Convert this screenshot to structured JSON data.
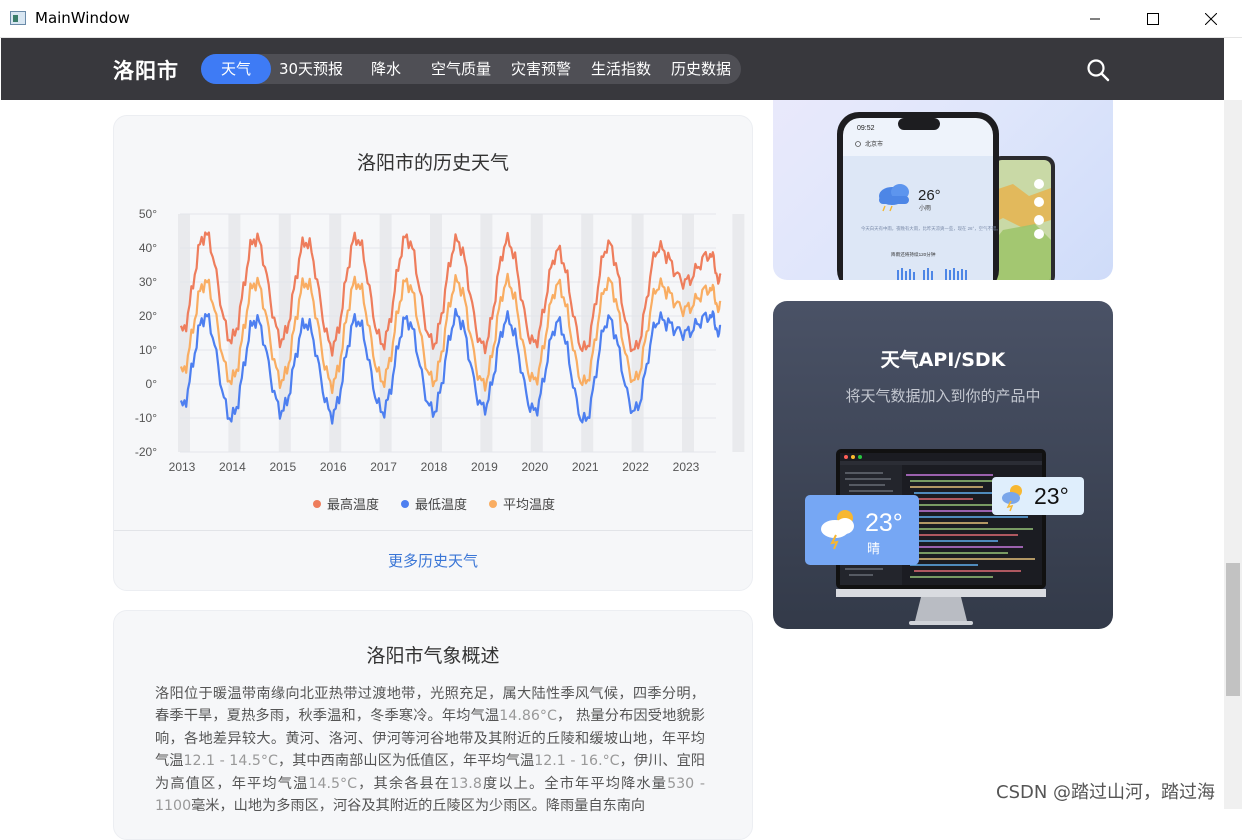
{
  "window": {
    "title": "MainWindow"
  },
  "nav": {
    "city": "洛阳市",
    "tabs": [
      {
        "label": "天气",
        "active": true
      },
      {
        "label": "30天预报",
        "active": false
      },
      {
        "label": "降水",
        "active": false
      },
      {
        "label": "空气质量",
        "active": false
      },
      {
        "label": "灾害预警",
        "active": false
      },
      {
        "label": "生活指数",
        "active": false
      },
      {
        "label": "历史数据",
        "active": false
      }
    ],
    "search_icon": "search-icon"
  },
  "history_card": {
    "title": "洛阳市的历史天气",
    "more_link": "更多历史天气"
  },
  "chart_data": {
    "type": "line",
    "title": "洛阳市的历史天气",
    "x": [
      "2013",
      "2014",
      "2015",
      "2016",
      "2017",
      "2018",
      "2019",
      "2020",
      "2021",
      "2022",
      "2023"
    ],
    "y_ticks": [
      "50°",
      "40°",
      "30°",
      "20°",
      "10°",
      "0°",
      "-10°",
      "-20°"
    ],
    "ylim": [
      -20,
      50
    ],
    "grid": true,
    "legend_position": "bottom",
    "series": [
      {
        "name": "最高温度",
        "color": "#ee7d5c",
        "summer_peaks": [
          44,
          43,
          42,
          43,
          43,
          42,
          42,
          39,
          41,
          40,
          38
        ],
        "winter_lows": [
          15,
          13,
          13,
          11,
          12,
          12,
          11,
          12,
          10,
          10,
          30
        ]
      },
      {
        "name": "最低温度",
        "color": "#4d7ff0",
        "summer_peaks": [
          20,
          19,
          18,
          19,
          19,
          20,
          19,
          18,
          19,
          19,
          20
        ],
        "winter_lows": [
          -7,
          -10,
          -8,
          -9,
          -8,
          -8,
          -7,
          -8,
          -11,
          -8,
          15
        ]
      },
      {
        "name": "平均温度",
        "color": "#f9ad62",
        "summer_peaks": [
          30,
          30,
          30,
          30,
          30,
          30,
          30,
          29,
          30,
          29,
          28
        ],
        "winter_lows": [
          3,
          1,
          1,
          0,
          1,
          1,
          0,
          1,
          0,
          1,
          22
        ]
      }
    ]
  },
  "summary_card": {
    "title": "洛阳市气象概述",
    "segments": [
      {
        "t": "洛阳位于暖温带南缘向北亚热带过渡地带，光照充足，属大陆性季风气候，四季分明，春季干旱，夏热多雨，秋季温和，冬季寒冷。年均气温",
        "num": false
      },
      {
        "t": "14.86°C",
        "num": true
      },
      {
        "t": "， 热量分布因受地貌影响，各地差异较大。黄河、洛河、伊河等河谷地带及其附近的丘陵和缓坡山地，年平均气温",
        "num": false
      },
      {
        "t": "12.1 - 14.5°C",
        "num": true
      },
      {
        "t": "，其中西南部山区为低值区，年平均气温",
        "num": false
      },
      {
        "t": "12.1 - 16.°C",
        "num": true
      },
      {
        "t": "，伊川、宜阳为高值区，年平均气温",
        "num": false
      },
      {
        "t": "14.5°C",
        "num": true
      },
      {
        "t": "，其余各县在",
        "num": false
      },
      {
        "t": "13.8",
        "num": true
      },
      {
        "t": "度以上。全市年平均降水量",
        "num": false
      },
      {
        "t": "530 - 1100",
        "num": true
      },
      {
        "t": "毫米，山地为多雨区，河谷及其附近的丘陵区为少雨区。降雨量自东南向",
        "num": false
      }
    ]
  },
  "promo_phone": {
    "time": "09:52",
    "city": "北京市",
    "temp": "26°",
    "condition": "小雨",
    "desc": "今天白天有中雨，夜晚有大雨，比昨天凉爽一些，现在 26°，空气不错。",
    "rain_note": "降雨还将持续120分钟"
  },
  "promo_api": {
    "title": "天气API/SDK",
    "subtitle": "将天气数据加入到你的产品中",
    "widget_large_temp": "23°",
    "widget_large_cond": "晴",
    "widget_small_temp": "23°"
  },
  "watermark": "CSDN @踏过山河，踏过海",
  "colors": {
    "nav_bg": "#38383d",
    "accent": "#3e7bf5",
    "link": "#3a76d6"
  }
}
